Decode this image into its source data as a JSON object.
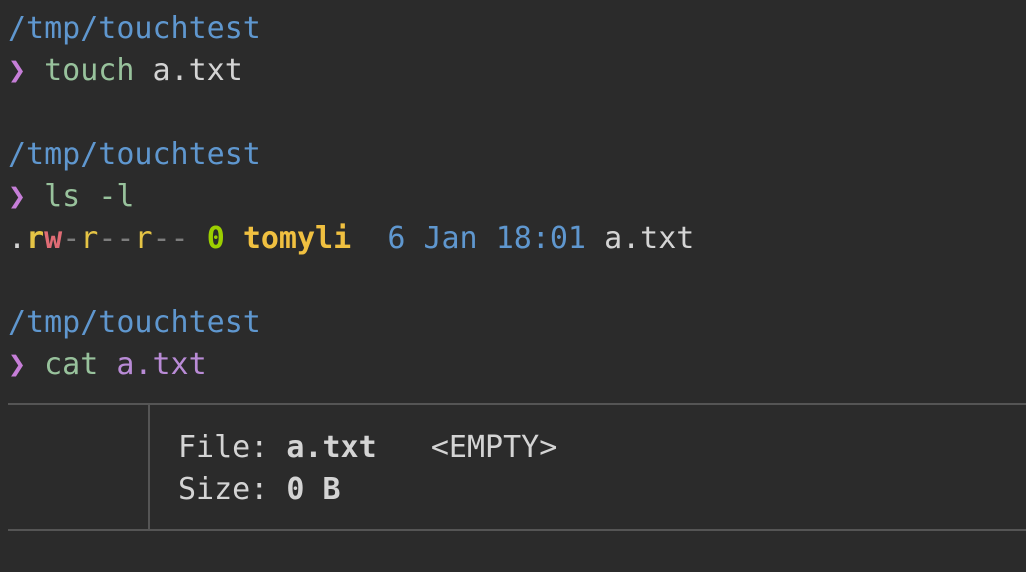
{
  "blocks": [
    {
      "path": "/tmp/touchtest",
      "prompt": "❯",
      "command": "touch",
      "args": "a.txt"
    },
    {
      "path": "/tmp/touchtest",
      "prompt": "❯",
      "command": "ls",
      "args": "-l",
      "listing": {
        "dot": ".",
        "p1": "r",
        "p2": "w",
        "p3": "-",
        "p4": "r",
        "p5": "--",
        "p6": "r",
        "p7": "--",
        "size": "0",
        "user": "tomyli",
        "day": "6",
        "month": "Jan",
        "time": "18:01",
        "file": "a.txt"
      }
    },
    {
      "path": "/tmp/touchtest",
      "prompt": "❯",
      "command": "cat",
      "args": "a.txt"
    }
  ],
  "bat": {
    "file_label": "File:",
    "file_name": "a.txt",
    "empty_tag": "<EMPTY>",
    "size_label": "Size:",
    "size_value": "0 B"
  },
  "colors": {
    "background": "#2b2b2b",
    "path": "#5f97cf",
    "prompt": "#c67ed8",
    "command": "#98c29c",
    "user": "#f0c040",
    "size": "#9ccf00",
    "write_perm": "#e06c75",
    "read_perm": "#e5c445"
  }
}
